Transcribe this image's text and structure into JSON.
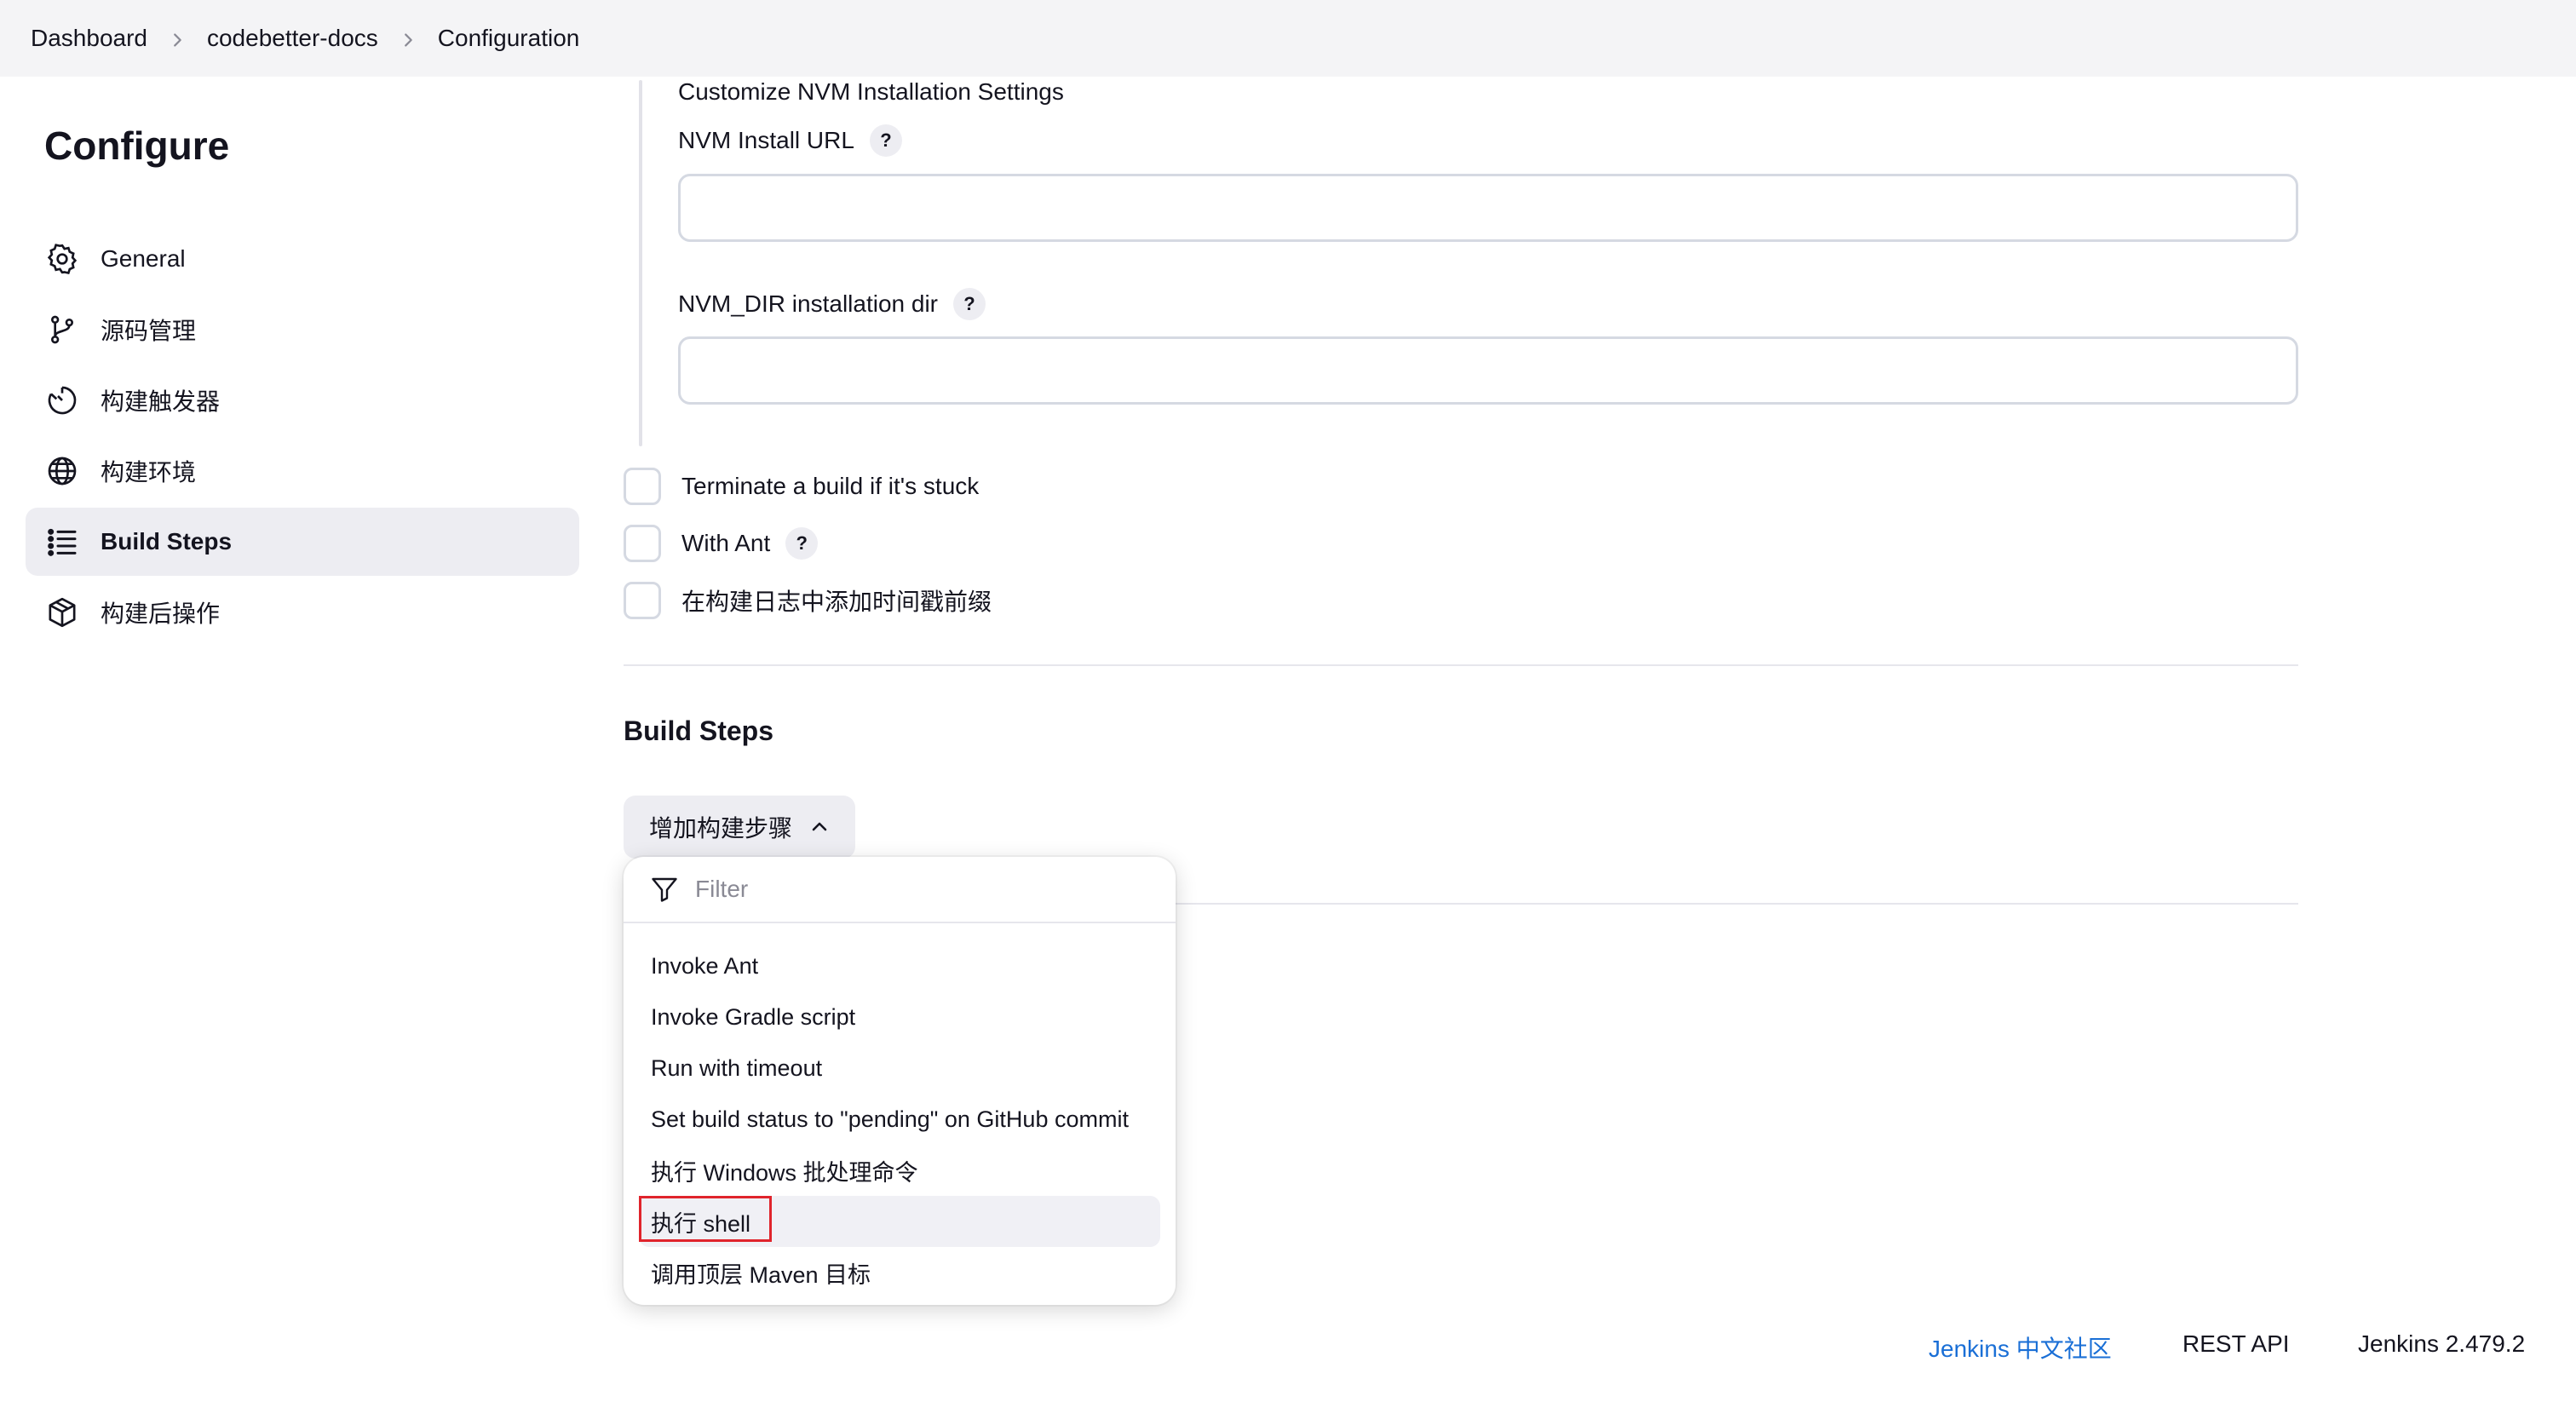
{
  "breadcrumb": {
    "items": [
      "Dashboard",
      "codebetter-docs",
      "Configuration"
    ]
  },
  "sidebar": {
    "title": "Configure",
    "items": [
      {
        "label": "General",
        "icon": "gear-icon"
      },
      {
        "label": "源码管理",
        "icon": "branch-icon"
      },
      {
        "label": "构建触发器",
        "icon": "timer-icon"
      },
      {
        "label": "构建环境",
        "icon": "globe-icon"
      },
      {
        "label": "Build Steps",
        "icon": "list-icon",
        "active": true
      },
      {
        "label": "构建后操作",
        "icon": "package-icon"
      }
    ]
  },
  "nvm": {
    "heading": "Customize NVM Installation Settings",
    "install_url_label": "NVM Install URL",
    "install_url_value": "",
    "dir_label": "NVM_DIR installation dir",
    "dir_value": "",
    "help_glyph": "?"
  },
  "options": [
    {
      "label": "Terminate a build if it's stuck",
      "checked": false,
      "help": false
    },
    {
      "label": "With Ant",
      "checked": false,
      "help": true
    },
    {
      "label": "在构建日志中添加时间戳前缀",
      "checked": false,
      "help": false
    }
  ],
  "build_steps": {
    "heading": "Build Steps",
    "add_button_label": "增加构建步骤",
    "dropdown": {
      "filter_placeholder": "Filter",
      "items": [
        "Invoke Ant",
        "Invoke Gradle script",
        "Run with timeout",
        "Set build status to \"pending\" on GitHub commit",
        "执行 Windows 批处理命令",
        "执行 shell",
        "调用顶层 Maven 目标"
      ],
      "hovered_item": "执行 shell"
    }
  },
  "footer": {
    "community_link": "Jenkins 中文社区",
    "rest_api": "REST API",
    "version": "Jenkins 2.479.2"
  },
  "colors": {
    "link": "#1a6fd6",
    "highlight": "#e0242c",
    "active_bg": "#ededf2"
  }
}
